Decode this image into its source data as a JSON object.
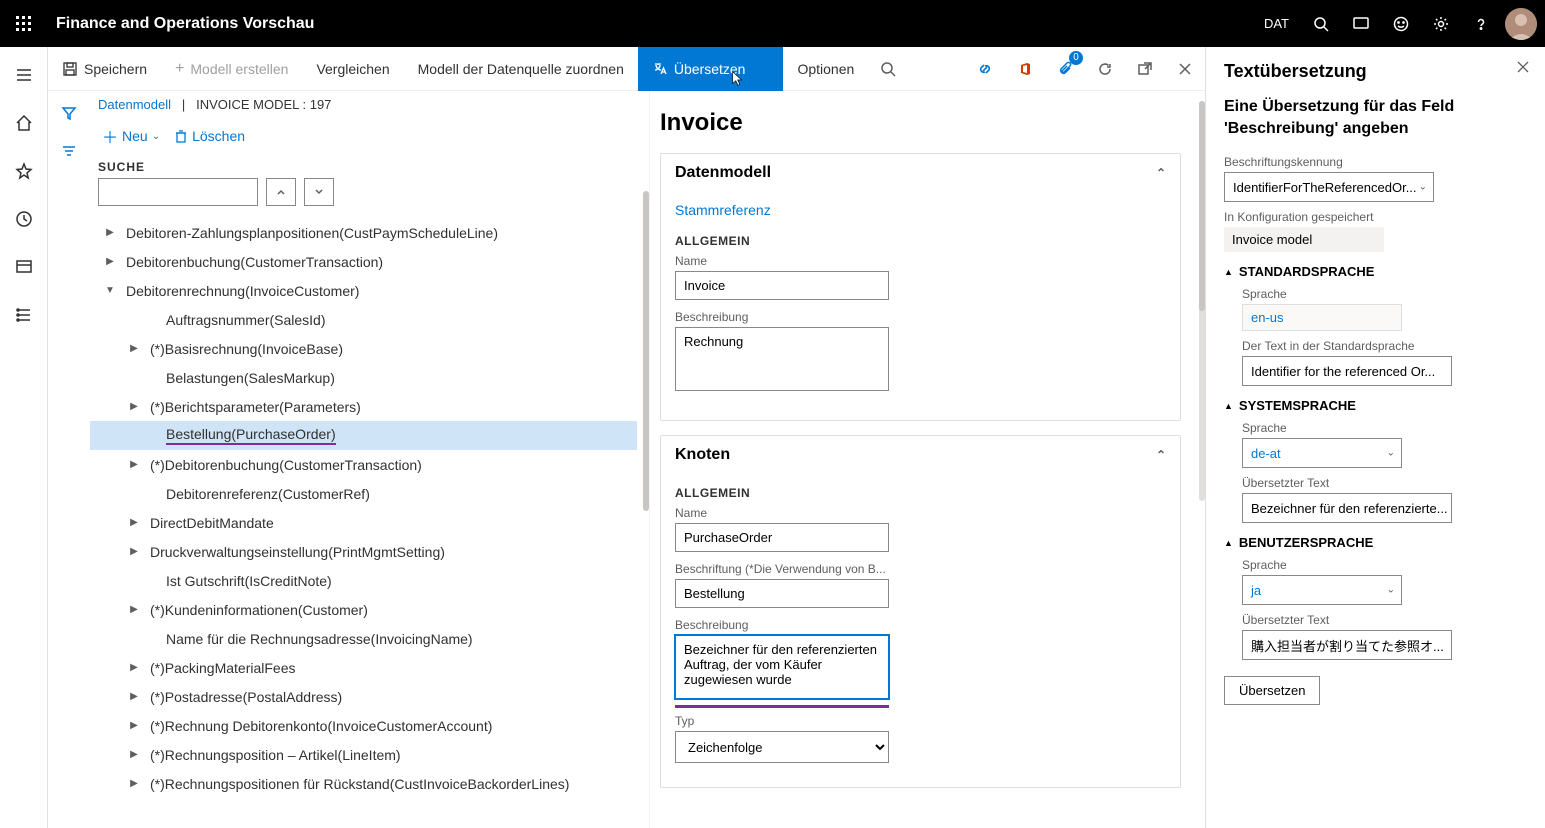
{
  "topbar": {
    "title": "Finance and Operations Vorschau",
    "company": "DAT"
  },
  "cmdbar": {
    "save": "Speichern",
    "newModel": "Modell erstellen",
    "compare": "Vergleichen",
    "mapDatasource": "Modell der Datenquelle zuordnen",
    "translate": "Übersetzen",
    "options": "Optionen",
    "badge": "0"
  },
  "breadcrumb": {
    "root": "Datenmodell",
    "sep": "|",
    "current": "INVOICE MODEL : 197"
  },
  "rowcmds": {
    "new": "Neu",
    "delete": "Löschen"
  },
  "search": {
    "label": "SUCHE",
    "value": ""
  },
  "tree": [
    {
      "caret": "▶",
      "depth": 0,
      "label": "Debitoren-Zahlungsplanpositionen(CustPaymScheduleLine)"
    },
    {
      "caret": "▶",
      "depth": 0,
      "label": "Debitorenbuchung(CustomerTransaction)"
    },
    {
      "caret": "▼",
      "depth": 0,
      "label": "Debitorenrechnung(InvoiceCustomer)"
    },
    {
      "caret": "",
      "depth": 1,
      "label": "Auftragsnummer(SalesId)"
    },
    {
      "caret": "▶",
      "depth": 1,
      "label": "(*)Basisrechnung(InvoiceBase)"
    },
    {
      "caret": "",
      "depth": 1,
      "label": "Belastungen(SalesMarkup)"
    },
    {
      "caret": "▶",
      "depth": 1,
      "label": "(*)Berichtsparameter(Parameters)"
    },
    {
      "caret": "",
      "depth": 1,
      "label": "Bestellung(PurchaseOrder)",
      "selected": true,
      "purple": true
    },
    {
      "caret": "▶",
      "depth": 1,
      "label": "(*)Debitorenbuchung(CustomerTransaction)"
    },
    {
      "caret": "",
      "depth": 1,
      "label": "Debitorenreferenz(CustomerRef)"
    },
    {
      "caret": "▶",
      "depth": 1,
      "label": "DirectDebitMandate"
    },
    {
      "caret": "▶",
      "depth": 1,
      "label": "Druckverwaltungseinstellung(PrintMgmtSetting)"
    },
    {
      "caret": "",
      "depth": 1,
      "label": "Ist Gutschrift(IsCreditNote)"
    },
    {
      "caret": "▶",
      "depth": 1,
      "label": "(*)Kundeninformationen(Customer)"
    },
    {
      "caret": "",
      "depth": 1,
      "label": "Name für die Rechnungsadresse(InvoicingName)"
    },
    {
      "caret": "▶",
      "depth": 1,
      "label": "(*)PackingMaterialFees"
    },
    {
      "caret": "▶",
      "depth": 1,
      "label": "(*)Postadresse(PostalAddress)"
    },
    {
      "caret": "▶",
      "depth": 1,
      "label": "(*)Rechnung Debitorenkonto(InvoiceCustomerAccount)"
    },
    {
      "caret": "▶",
      "depth": 1,
      "label": "(*)Rechnungsposition – Artikel(LineItem)"
    },
    {
      "caret": "▶",
      "depth": 1,
      "label": "(*)Rechnungspositionen für Rückstand(CustInvoiceBackorderLines)"
    }
  ],
  "details": {
    "heading": "Invoice",
    "card1": {
      "title": "Datenmodell",
      "link": "Stammreferenz",
      "section": "ALLGEMEIN",
      "name_lbl": "Name",
      "name_val": "Invoice",
      "desc_lbl": "Beschreibung",
      "desc_val": "Rechnung"
    },
    "card2": {
      "title": "Knoten",
      "section": "ALLGEMEIN",
      "name_lbl": "Name",
      "name_val": "PurchaseOrder",
      "caption_lbl": "Beschriftung (*Die Verwendung von B...",
      "caption_val": "Bestellung",
      "desc_lbl": "Beschreibung",
      "desc_val": "Bezeichner für den referenzierten Auftrag, der vom Käufer zugewiesen wurde",
      "type_lbl": "Typ",
      "type_val": "Zeichenfolge"
    }
  },
  "trans": {
    "heading": "Textübersetzung",
    "sub": "Eine Übersetzung für das Feld 'Beschreibung' angeben",
    "labelid_lbl": "Beschriftungskennung",
    "labelid_val": "IdentifierForTheReferencedOr...",
    "savedin_lbl": "In Konfiguration gespeichert",
    "savedin_val": "Invoice model",
    "std_head": "STANDARDSPRACHE",
    "std_lang_lbl": "Sprache",
    "std_lang_val": "en-us",
    "std_text_lbl": "Der Text in der Standardsprache",
    "std_text_val": "Identifier for the referenced Or...",
    "sys_head": "SYSTEMSPRACHE",
    "sys_lang_lbl": "Sprache",
    "sys_lang_val": "de-at",
    "sys_text_lbl": "Übersetzter Text",
    "sys_text_val": "Bezeichner für den referenzierte...",
    "usr_head": "BENUTZERSPRACHE",
    "usr_lang_lbl": "Sprache",
    "usr_lang_val": "ja",
    "usr_text_lbl": "Übersetzter Text",
    "usr_text_val": "購入担当者が割り当てた参照オ...",
    "btn": "Übersetzen"
  }
}
